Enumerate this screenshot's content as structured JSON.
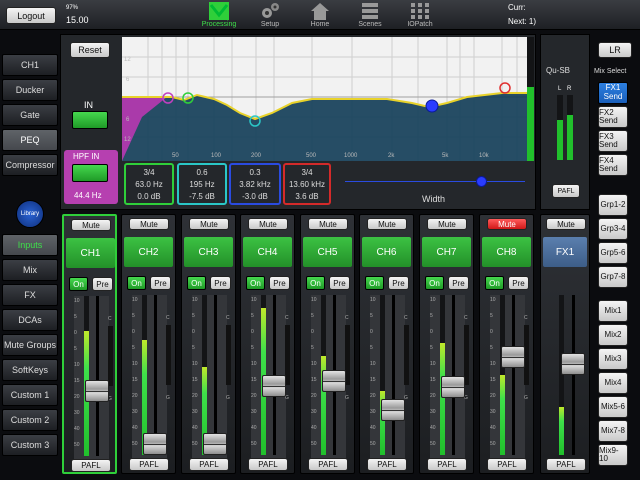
{
  "top": {
    "logout": "Logout",
    "battery": "97%",
    "time": "15.00",
    "curr": "Curr:",
    "next": "Next: 1)"
  },
  "nav": [
    {
      "label": "Processing",
      "icon": "processing-icon",
      "selected": true
    },
    {
      "label": "Setup",
      "icon": "gear-icon"
    },
    {
      "label": "Home",
      "icon": "home-icon"
    },
    {
      "label": "Scenes",
      "icon": "scenes-icon"
    },
    {
      "label": "IOPatch",
      "icon": "iopatch-icon"
    }
  ],
  "left_tabs": [
    "CH1",
    "Ducker",
    "Gate",
    "PEQ",
    "Compressor"
  ],
  "library": "Library",
  "layers": [
    "Inputs",
    "Mix",
    "FX",
    "DCAs",
    "Mute Groups",
    "SoftKeys",
    "Custom 1",
    "Custom 2",
    "Custom 3"
  ],
  "peq": {
    "reset": "Reset",
    "in": "IN",
    "hpf_in": "HPF IN",
    "hpf_freq": "44.4 Hz",
    "y_ticks_top": [
      "12",
      "6"
    ],
    "y_ticks_bottom": [
      "6",
      "12"
    ],
    "x_ticks": [
      "50",
      "100",
      "200",
      "500",
      "1000",
      "2k",
      "5k",
      "10k"
    ],
    "bands": [
      {
        "q": "3/4",
        "freq": "63.0 Hz",
        "gain": "0.0 dB",
        "color": "#2fcf3a"
      },
      {
        "q": "0.6",
        "freq": "195 Hz",
        "gain": "-7.5 dB",
        "color": "#2ac7c7"
      },
      {
        "q": "0.3",
        "freq": "3.82 kHz",
        "gain": "-3.0 dB",
        "color": "#2a5bff"
      },
      {
        "q": "3/4",
        "freq": "13.60 kHz",
        "gain": "3.6 dB",
        "color": "#e03030"
      }
    ],
    "width_label": "Width"
  },
  "channels": [
    {
      "name": "CH1",
      "mute": "Mute",
      "on": "On",
      "pre": "Pre",
      "pafl": "PAFL",
      "fader": 0.42,
      "meter": 0.78,
      "muted": false,
      "selected": true
    },
    {
      "name": "CH2",
      "mute": "Mute",
      "on": "On",
      "pre": "Pre",
      "pafl": "PAFL",
      "fader": 0.05,
      "meter": 0.72,
      "muted": false
    },
    {
      "name": "CH3",
      "mute": "Mute",
      "on": "On",
      "pre": "Pre",
      "pafl": "PAFL",
      "fader": 0.05,
      "meter": 0.55,
      "muted": false
    },
    {
      "name": "CH4",
      "mute": "Mute",
      "on": "On",
      "pre": "Pre",
      "pafl": "PAFL",
      "fader": 0.45,
      "meter": 0.92,
      "muted": false
    },
    {
      "name": "CH5",
      "mute": "Mute",
      "on": "On",
      "pre": "Pre",
      "pafl": "PAFL",
      "fader": 0.48,
      "meter": 0.62,
      "muted": false
    },
    {
      "name": "CH6",
      "mute": "Mute",
      "on": "On",
      "pre": "Pre",
      "pafl": "PAFL",
      "fader": 0.28,
      "meter": 0.4,
      "muted": false
    },
    {
      "name": "CH7",
      "mute": "Mute",
      "on": "On",
      "pre": "Pre",
      "pafl": "PAFL",
      "fader": 0.44,
      "meter": 0.7,
      "muted": false
    },
    {
      "name": "CH8",
      "mute": "Mute",
      "on": "On",
      "pre": "Pre",
      "pafl": "PAFL",
      "fader": 0.65,
      "meter": 0.5,
      "muted": true
    }
  ],
  "fader_scale": [
    "10",
    "5",
    "0",
    "5",
    "10",
    "15",
    "20",
    "30",
    "40",
    "50"
  ],
  "meter_labels": {
    "c": "C",
    "g": "G"
  },
  "right": {
    "lr": "LR",
    "device": "Qu-SB",
    "mix_select": "Mix Select",
    "meter_l": "L",
    "meter_r": "R",
    "pafl": "PAFL",
    "sends": [
      "FX1 Send",
      "FX2 Send",
      "FX3 Send",
      "FX4 Send"
    ],
    "groups": [
      "Grp1-2",
      "Grp3-4",
      "Grp5-6",
      "Grp7-8"
    ],
    "mixes": [
      "Mix1",
      "Mix2",
      "Mix3",
      "Mix4",
      "Mix5-6",
      "Mix7-8",
      "Mix9-10"
    ],
    "fx": {
      "name": "FX1",
      "mute": "Mute",
      "pafl": "PAFL",
      "fader": 0.6,
      "meter": 0.3
    }
  }
}
